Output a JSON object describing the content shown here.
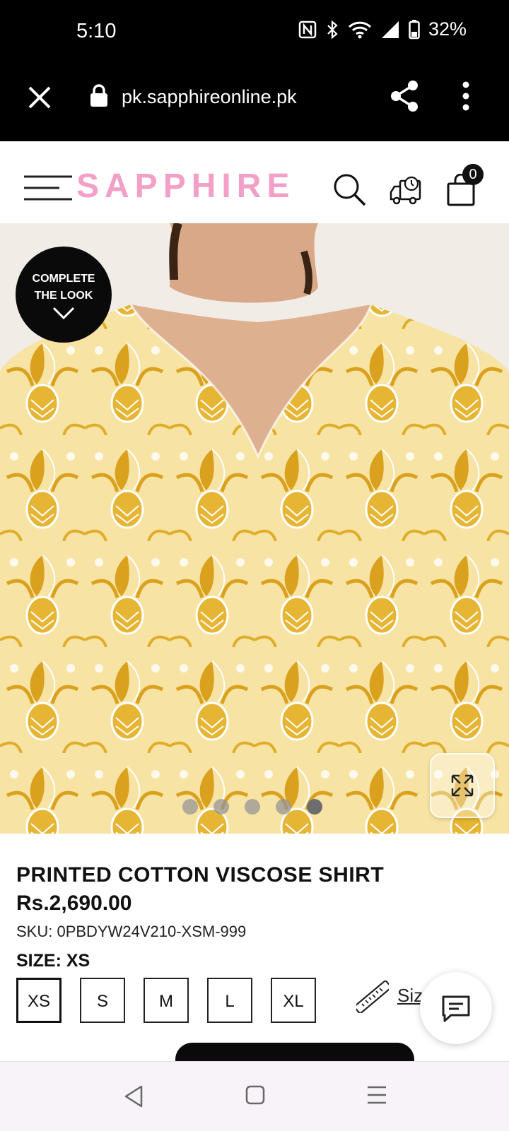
{
  "status_bar": {
    "time": "5:10",
    "battery": "32%",
    "icons": [
      "nfc-icon",
      "bluetooth-icon",
      "wifi-icon",
      "signal-icon",
      "battery-icon"
    ]
  },
  "browser": {
    "url": "pk.sapphireonline.pk",
    "icons": [
      "close-icon",
      "lock-icon",
      "share-icon",
      "more-vert-icon"
    ]
  },
  "header": {
    "logo": "SAPPHIRE",
    "logo_color": "#f3a0c8",
    "bag_count": "0",
    "icons": [
      "hamburger-icon",
      "search-icon",
      "delivery-truck-icon",
      "shopping-bag-icon"
    ]
  },
  "hero": {
    "badge_line1": "COMPLETE",
    "badge_line2": "THE LOOK",
    "carousel_dots": 5,
    "active_dot": 5,
    "fabric_color": "#d9a11e",
    "background_color": "#f7e3a3"
  },
  "product": {
    "title": "PRINTED COTTON VISCOSE SHIRT",
    "price": "Rs.2,690.00",
    "sku": "SKU: 0PBDYW24V210-XSM-999",
    "size_label": "SIZE: XS",
    "sizes": [
      "XS",
      "S",
      "M",
      "L",
      "XL"
    ],
    "selected_size": "XS",
    "size_guide": "Siz"
  }
}
